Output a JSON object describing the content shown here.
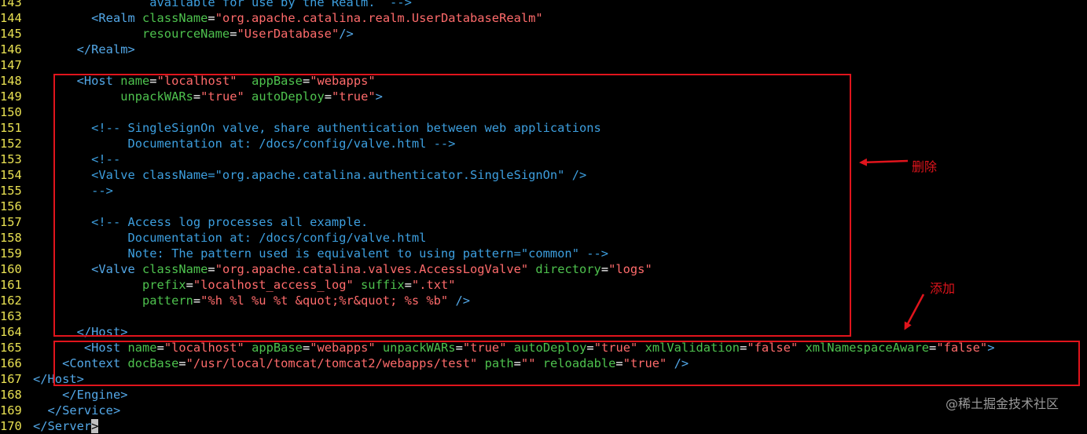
{
  "editor": {
    "lines": [
      {
        "num": "143",
        "indent": 16,
        "tokens": [
          {
            "t": "cmt",
            "v": "available for use by the Realm.  -->"
          }
        ]
      },
      {
        "num": "144",
        "indent": 8,
        "tokens": [
          {
            "t": "tag",
            "v": "<Realm "
          },
          {
            "t": "attr",
            "v": "className"
          },
          {
            "t": "txt",
            "v": "="
          },
          {
            "t": "str",
            "v": "\"org.apache.catalina.realm.UserDatabaseRealm\""
          }
        ]
      },
      {
        "num": "145",
        "indent": 15,
        "tokens": [
          {
            "t": "attr",
            "v": "resourceName"
          },
          {
            "t": "txt",
            "v": "="
          },
          {
            "t": "str",
            "v": "\"UserDatabase\""
          },
          {
            "t": "tag",
            "v": "/>"
          }
        ]
      },
      {
        "num": "146",
        "indent": 6,
        "tokens": [
          {
            "t": "tag",
            "v": "</Realm>"
          }
        ]
      },
      {
        "num": "147",
        "indent": 0,
        "tokens": []
      },
      {
        "num": "148",
        "indent": 6,
        "tokens": [
          {
            "t": "tag",
            "v": "<Host "
          },
          {
            "t": "attr",
            "v": "name"
          },
          {
            "t": "txt",
            "v": "="
          },
          {
            "t": "str",
            "v": "\"localhost\""
          },
          {
            "t": "txt",
            "v": "  "
          },
          {
            "t": "attr",
            "v": "appBase"
          },
          {
            "t": "txt",
            "v": "="
          },
          {
            "t": "str",
            "v": "\"webapps\""
          }
        ]
      },
      {
        "num": "149",
        "indent": 12,
        "tokens": [
          {
            "t": "attr",
            "v": "unpackWARs"
          },
          {
            "t": "txt",
            "v": "="
          },
          {
            "t": "str",
            "v": "\"true\""
          },
          {
            "t": "txt",
            "v": " "
          },
          {
            "t": "attr",
            "v": "autoDeploy"
          },
          {
            "t": "txt",
            "v": "="
          },
          {
            "t": "str",
            "v": "\"true\""
          },
          {
            "t": "tag",
            "v": ">"
          }
        ]
      },
      {
        "num": "150",
        "indent": 0,
        "tokens": []
      },
      {
        "num": "151",
        "indent": 8,
        "tokens": [
          {
            "t": "cmt",
            "v": "<!-- SingleSignOn valve, share authentication between web applications"
          }
        ]
      },
      {
        "num": "152",
        "indent": 13,
        "tokens": [
          {
            "t": "cmt",
            "v": "Documentation at: /docs/config/valve.html -->"
          }
        ]
      },
      {
        "num": "153",
        "indent": 8,
        "tokens": [
          {
            "t": "cmt",
            "v": "<!--"
          }
        ]
      },
      {
        "num": "154",
        "indent": 8,
        "tokens": [
          {
            "t": "cmt",
            "v": "<Valve className=\"org.apache.catalina.authenticator.SingleSignOn\" />"
          }
        ]
      },
      {
        "num": "155",
        "indent": 8,
        "tokens": [
          {
            "t": "cmt",
            "v": "-->"
          }
        ]
      },
      {
        "num": "156",
        "indent": 0,
        "tokens": []
      },
      {
        "num": "157",
        "indent": 8,
        "tokens": [
          {
            "t": "cmt",
            "v": "<!-- Access log processes all example."
          }
        ]
      },
      {
        "num": "158",
        "indent": 13,
        "tokens": [
          {
            "t": "cmt",
            "v": "Documentation at: /docs/config/valve.html"
          }
        ]
      },
      {
        "num": "159",
        "indent": 13,
        "tokens": [
          {
            "t": "cmt",
            "v": "Note: The pattern used is equivalent to using pattern=\"common\" -->"
          }
        ]
      },
      {
        "num": "160",
        "indent": 8,
        "tokens": [
          {
            "t": "tag",
            "v": "<Valve "
          },
          {
            "t": "attr",
            "v": "className"
          },
          {
            "t": "txt",
            "v": "="
          },
          {
            "t": "str",
            "v": "\"org.apache.catalina.valves.AccessLogValve\""
          },
          {
            "t": "txt",
            "v": " "
          },
          {
            "t": "attr",
            "v": "directory"
          },
          {
            "t": "txt",
            "v": "="
          },
          {
            "t": "str",
            "v": "\"logs\""
          }
        ]
      },
      {
        "num": "161",
        "indent": 15,
        "tokens": [
          {
            "t": "attr",
            "v": "prefix"
          },
          {
            "t": "txt",
            "v": "="
          },
          {
            "t": "str",
            "v": "\"localhost_access_log\""
          },
          {
            "t": "txt",
            "v": " "
          },
          {
            "t": "attr",
            "v": "suffix"
          },
          {
            "t": "txt",
            "v": "="
          },
          {
            "t": "str",
            "v": "\".txt\""
          }
        ]
      },
      {
        "num": "162",
        "indent": 15,
        "tokens": [
          {
            "t": "attr",
            "v": "pattern"
          },
          {
            "t": "txt",
            "v": "="
          },
          {
            "t": "str",
            "v": "\"%h %l %u %t &quot;%r&quot; %s %b\""
          },
          {
            "t": "txt",
            "v": " "
          },
          {
            "t": "tag",
            "v": "/>"
          }
        ]
      },
      {
        "num": "163",
        "indent": 0,
        "tokens": []
      },
      {
        "num": "164",
        "indent": 6,
        "tokens": [
          {
            "t": "tag",
            "v": "</Host>"
          }
        ]
      },
      {
        "num": "165",
        "indent": 7,
        "tokens": [
          {
            "t": "tag",
            "v": "<Host "
          },
          {
            "t": "attr",
            "v": "name"
          },
          {
            "t": "txt",
            "v": "="
          },
          {
            "t": "str",
            "v": "\"localhost\""
          },
          {
            "t": "txt",
            "v": " "
          },
          {
            "t": "attr",
            "v": "appBase"
          },
          {
            "t": "txt",
            "v": "="
          },
          {
            "t": "str",
            "v": "\"webapps\""
          },
          {
            "t": "txt",
            "v": " "
          },
          {
            "t": "attr",
            "v": "unpackWARs"
          },
          {
            "t": "txt",
            "v": "="
          },
          {
            "t": "str",
            "v": "\"true\""
          },
          {
            "t": "txt",
            "v": " "
          },
          {
            "t": "attr",
            "v": "autoDeploy"
          },
          {
            "t": "txt",
            "v": "="
          },
          {
            "t": "str",
            "v": "\"true\""
          },
          {
            "t": "txt",
            "v": " "
          },
          {
            "t": "attr",
            "v": "xmlValidation"
          },
          {
            "t": "txt",
            "v": "="
          },
          {
            "t": "str",
            "v": "\"false\""
          },
          {
            "t": "txt",
            "v": " "
          },
          {
            "t": "attr",
            "v": "xmlNamespaceAware"
          },
          {
            "t": "txt",
            "v": "="
          },
          {
            "t": "str",
            "v": "\"false\""
          },
          {
            "t": "tag",
            "v": ">"
          }
        ]
      },
      {
        "num": "166",
        "indent": 4,
        "tokens": [
          {
            "t": "tag",
            "v": "<Context "
          },
          {
            "t": "attr",
            "v": "docBase"
          },
          {
            "t": "txt",
            "v": "="
          },
          {
            "t": "str",
            "v": "\"/usr/local/tomcat/tomcat2/webapps/test\""
          },
          {
            "t": "txt",
            "v": " "
          },
          {
            "t": "attr",
            "v": "path"
          },
          {
            "t": "txt",
            "v": "="
          },
          {
            "t": "str",
            "v": "\"\""
          },
          {
            "t": "txt",
            "v": " "
          },
          {
            "t": "attr",
            "v": "reloadable"
          },
          {
            "t": "txt",
            "v": "="
          },
          {
            "t": "str",
            "v": "\"true\""
          },
          {
            "t": "txt",
            "v": " "
          },
          {
            "t": "tag",
            "v": "/>"
          }
        ]
      },
      {
        "num": "167",
        "indent": 0,
        "tokens": [
          {
            "t": "tag",
            "v": "</Host>"
          }
        ]
      },
      {
        "num": "168",
        "indent": 4,
        "tokens": [
          {
            "t": "tag",
            "v": "</Engine>"
          }
        ]
      },
      {
        "num": "169",
        "indent": 2,
        "tokens": [
          {
            "t": "tag",
            "v": "</Service>"
          }
        ]
      },
      {
        "num": "170",
        "indent": 0,
        "tokens": [
          {
            "t": "tag",
            "v": "</Server"
          },
          {
            "t": "cursor",
            "v": ">"
          }
        ]
      }
    ]
  },
  "annotations": {
    "delete_label": "删除",
    "add_label": "添加"
  },
  "colors": {
    "background": "#000000",
    "line_number": "#e8e052",
    "tag": "#53a8e8",
    "attribute": "#4ec24e",
    "string": "#ff6b6b",
    "comment": "#3d9fdf",
    "annotation": "#e0141c"
  },
  "watermark": "@稀土掘金技术社区"
}
